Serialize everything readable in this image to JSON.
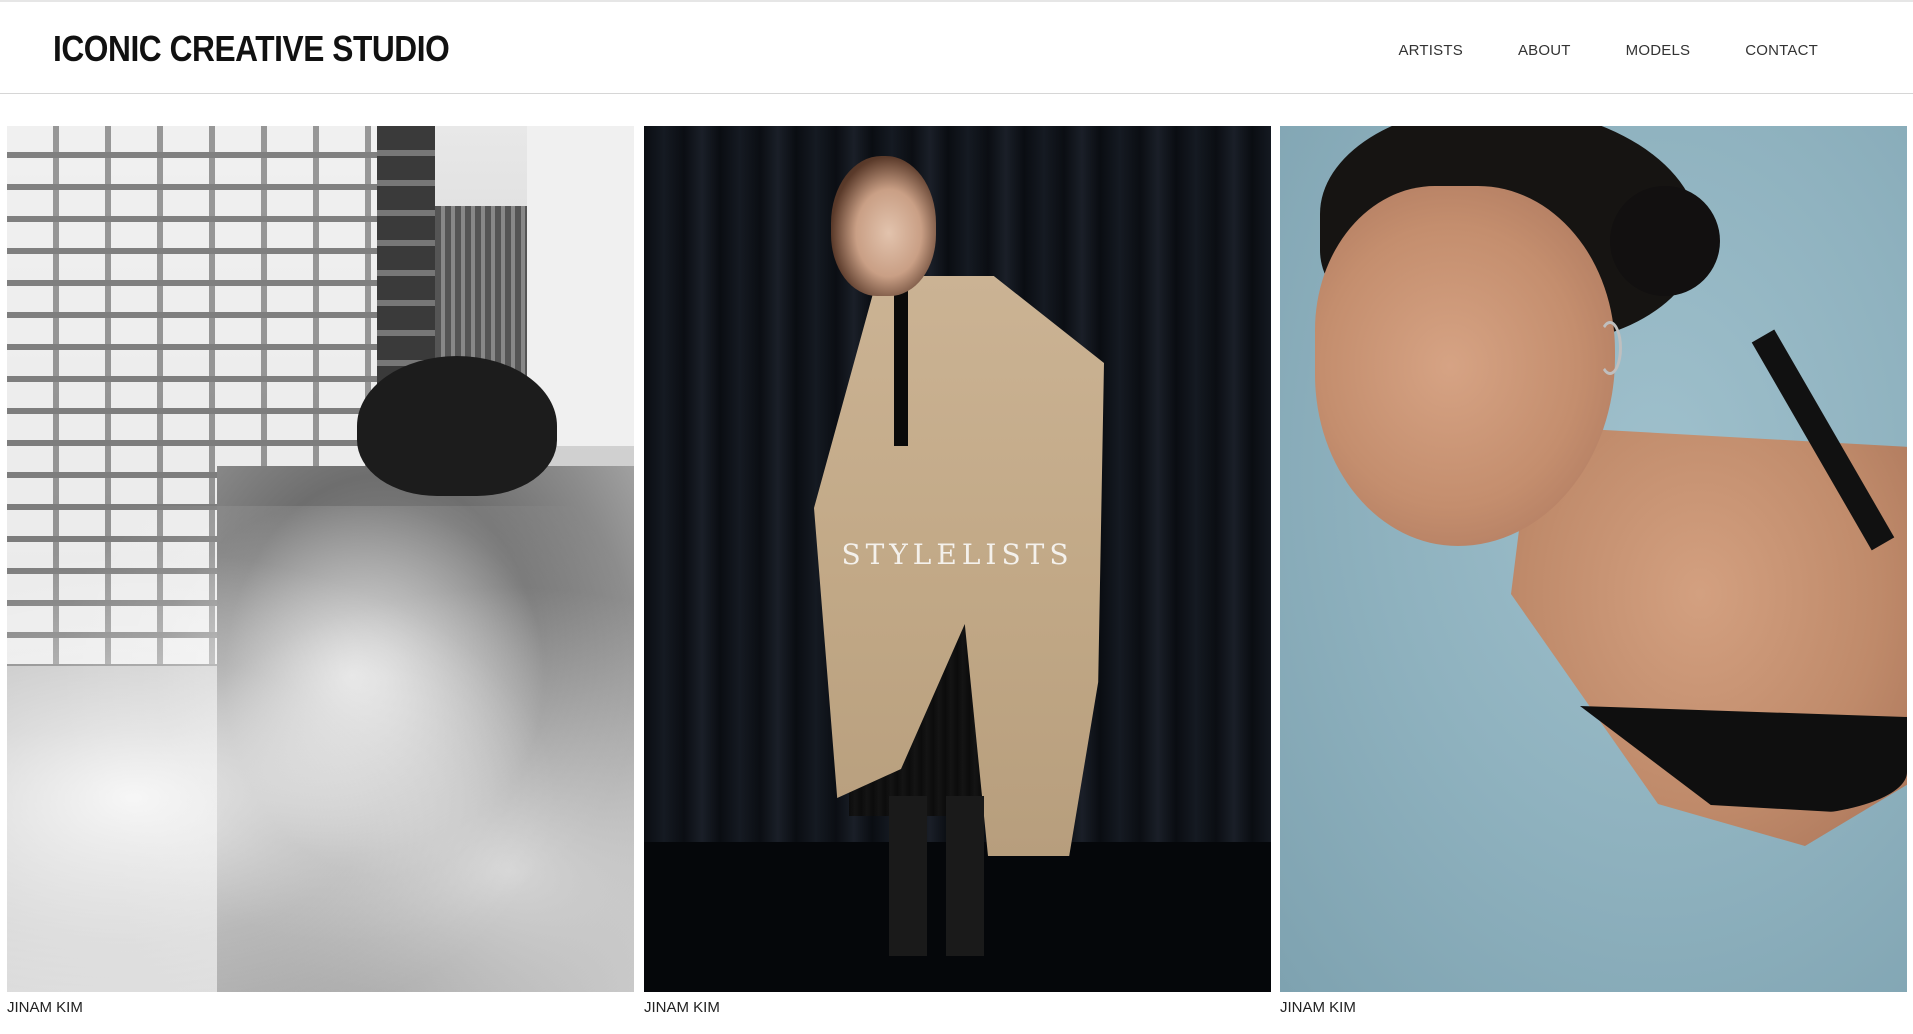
{
  "header": {
    "logo": "ICONIC CREATIVE STUDIO",
    "nav": [
      {
        "label": "ARTISTS"
      },
      {
        "label": "ABOUT"
      },
      {
        "label": "MODELS"
      },
      {
        "label": "CONTACT"
      }
    ]
  },
  "gallery": {
    "cards": [
      {
        "caption": "JINAM KIM",
        "overlay": ""
      },
      {
        "caption": "JINAM KIM",
        "overlay": "STYLELISTS"
      },
      {
        "caption": "JINAM KIM",
        "overlay": ""
      }
    ]
  }
}
